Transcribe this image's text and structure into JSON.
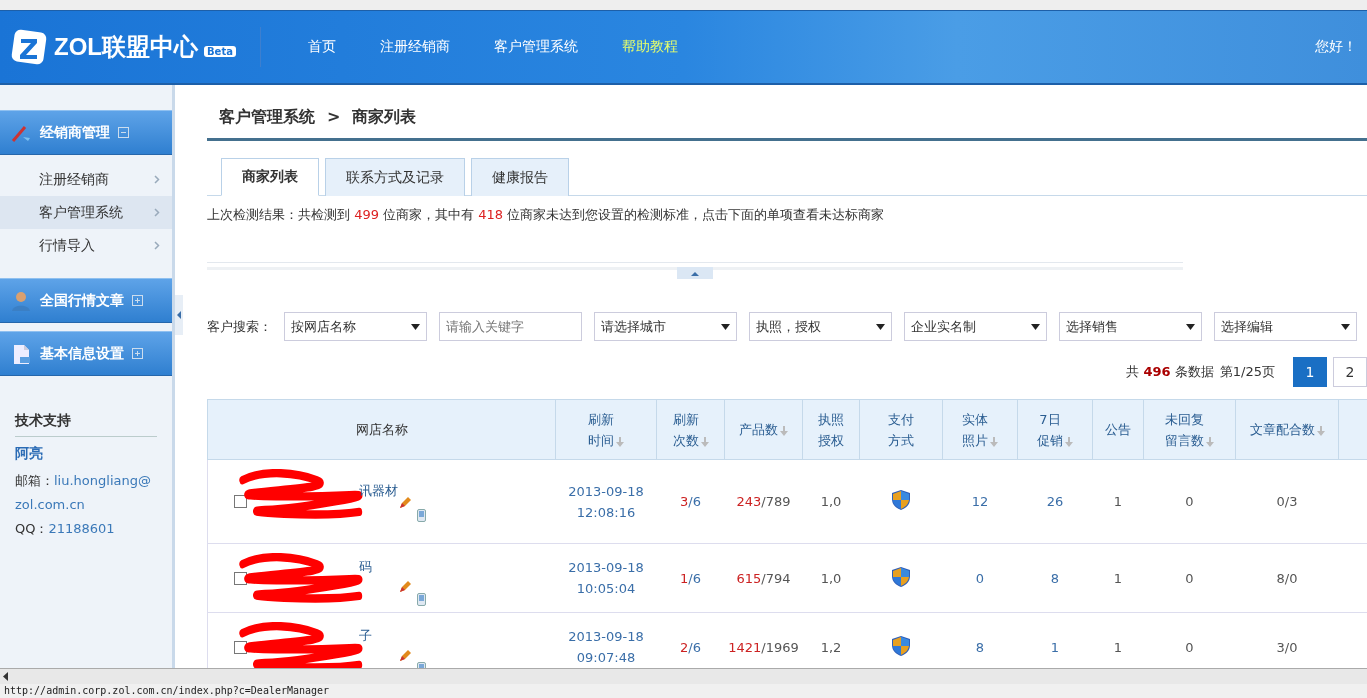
{
  "header": {
    "logo": "ZOL联盟中心",
    "logo_badge": "Beta",
    "nav": [
      {
        "label": "首页",
        "highlight": false
      },
      {
        "label": "注册经销商",
        "highlight": false
      },
      {
        "label": "客户管理系统",
        "highlight": false
      },
      {
        "label": "帮助教程",
        "highlight": true
      }
    ],
    "greeting": "您好！"
  },
  "sidebar": {
    "groups": [
      {
        "title": "经销商管理",
        "expanded": true,
        "items": [
          {
            "label": "注册经销商",
            "selected": false
          },
          {
            "label": "客户管理系统",
            "selected": true
          },
          {
            "label": "行情导入",
            "selected": false
          }
        ]
      },
      {
        "title": "全国行情文章",
        "expanded": false
      },
      {
        "title": "基本信息设置",
        "expanded": false
      }
    ],
    "support": {
      "title": "技术支持",
      "name": "阿亮",
      "email_label": "邮箱：",
      "email": "liu.hongliang@zol.com.cn",
      "qq_label": "QQ：",
      "qq": "21188601"
    }
  },
  "breadcrumb": [
    "客户管理系统",
    "商家列表"
  ],
  "breadcrumb_separator": ">",
  "tabs": [
    {
      "label": "商家列表",
      "selected": true
    },
    {
      "label": "联系方式及记录",
      "selected": false
    },
    {
      "label": "健康报告",
      "selected": false
    }
  ],
  "notice": [
    {
      "text": "上次检测结果：共检测到 ",
      "highlight": false
    },
    {
      "text": "499",
      "highlight": true
    },
    {
      "text": " 位商家，其中有 ",
      "highlight": false
    },
    {
      "text": "418",
      "highlight": true
    },
    {
      "text": " 位商家未达到您设置的检测标准，点击下面的单项查看未达标商家",
      "highlight": false
    }
  ],
  "search": {
    "label": "客户搜索：",
    "fields": [
      {
        "kind": "select",
        "value": "按网店名称"
      },
      {
        "kind": "input",
        "placeholder": "请输入关键字"
      },
      {
        "kind": "select",
        "value": "请选择城市"
      },
      {
        "kind": "select",
        "value": "执照，授权"
      },
      {
        "kind": "select",
        "value": "企业实名制"
      },
      {
        "kind": "select",
        "value": "选择销售"
      },
      {
        "kind": "select",
        "value": "选择编辑"
      }
    ]
  },
  "pagination": {
    "prefix": "共",
    "total": "496",
    "suffix": "条数据",
    "page_info": "第1/25页",
    "pages": [
      {
        "label": "1",
        "selected": true
      },
      {
        "label": "2",
        "selected": false
      }
    ]
  },
  "table": {
    "columns": [
      {
        "lines": [
          "网店名称"
        ],
        "sortable": false
      },
      {
        "lines": [
          "刷新",
          "时间"
        ],
        "sortable": true
      },
      {
        "lines": [
          "刷新",
          "次数"
        ],
        "sortable": true
      },
      {
        "lines": [
          "产品数"
        ],
        "sortable": true
      },
      {
        "lines": [
          "执照",
          "授权"
        ],
        "sortable": false
      },
      {
        "lines": [
          "支付",
          "方式"
        ],
        "sortable": false
      },
      {
        "lines": [
          "实体",
          "照片"
        ],
        "sortable": true
      },
      {
        "lines": [
          "7日",
          "促销"
        ],
        "sortable": true
      },
      {
        "lines": [
          "公告"
        ],
        "sortable": false
      },
      {
        "lines": [
          "未回复",
          "留言数"
        ],
        "sortable": true
      },
      {
        "lines": [
          "文章配合数"
        ],
        "sortable": true
      }
    ],
    "rows": [
      {
        "checked": false,
        "name_fragment": "讯器材",
        "date": "2013-09-18",
        "time": "12:08:16",
        "refresh_done": "3",
        "refresh_rest": "/6",
        "products_done": "243",
        "products_rest": "/789",
        "license": "1,0",
        "photos": "12",
        "promos": "26",
        "notices": "1",
        "unreplied": "0",
        "articles": "0/3"
      },
      {
        "checked": false,
        "name_fragment": "码",
        "date": "2013-09-18",
        "time": "10:05:04",
        "refresh_done": "1",
        "refresh_rest": "/6",
        "products_done": "615",
        "products_rest": "/794",
        "license": "1,0",
        "photos": "0",
        "promos": "8",
        "notices": "1",
        "unreplied": "0",
        "articles": "8/0"
      },
      {
        "checked": false,
        "name_fragment": "子",
        "date": "2013-09-18",
        "time": "09:07:48",
        "refresh_done": "2",
        "refresh_rest": "/6",
        "products_done": "1421",
        "products_rest": "/1969",
        "license": "1,2",
        "photos": "8",
        "promos": "1",
        "notices": "1",
        "unreplied": "0",
        "articles": "3/0"
      }
    ]
  },
  "status_bar": {
    "url": "http://admin.corp.zol.com.cn/index.php?c=DealerManager"
  }
}
